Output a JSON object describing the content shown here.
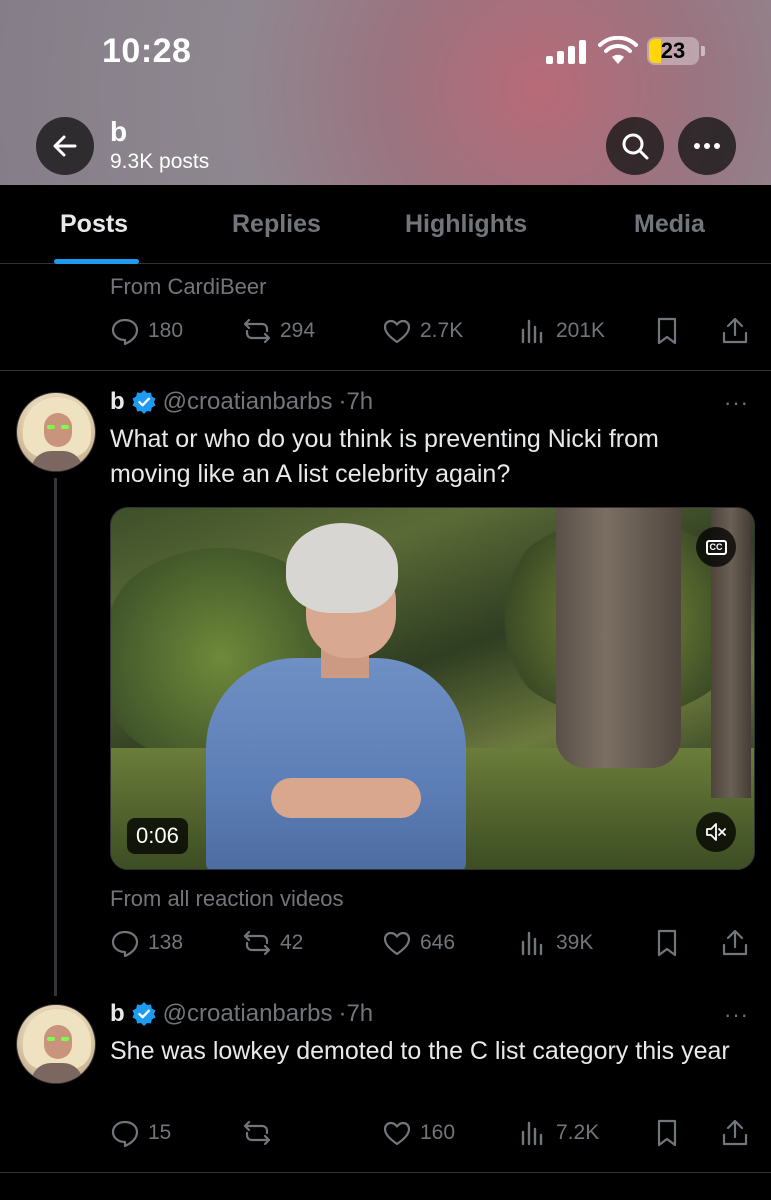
{
  "status_bar": {
    "time": "10:28",
    "battery": "23"
  },
  "header": {
    "name": "b",
    "post_count": "9.3K posts"
  },
  "tabs": [
    {
      "label": "Posts",
      "active": true
    },
    {
      "label": "Replies",
      "active": false
    },
    {
      "label": "Highlights",
      "active": false
    },
    {
      "label": "Media",
      "active": false
    }
  ],
  "top_post": {
    "from": "From CardiBeer",
    "replies": "180",
    "reposts": "294",
    "likes": "2.7K",
    "views": "201K"
  },
  "posts": [
    {
      "name": "b",
      "handle": "@croatianbarbs",
      "time": "·7h",
      "text": "What or who do you think is preventing Nicki from moving like an A list celebrity again?",
      "video_duration": "0:06",
      "from": "From all reaction videos",
      "replies": "138",
      "reposts": "42",
      "likes": "646",
      "views": "39K"
    },
    {
      "name": "b",
      "handle": "@croatianbarbs",
      "time": "·7h",
      "text": "She was lowkey demoted to the C list category this year",
      "replies": "15",
      "reposts": "",
      "likes": "160",
      "views": "7.2K"
    }
  ],
  "more_symbol": "···",
  "colors": {
    "accent": "#1d9bf0",
    "muted": "#71767b",
    "text": "#e7e9ea",
    "background": "#000000"
  },
  "icons": [
    "back-arrow-icon",
    "search-icon",
    "more-icon",
    "verified-icon",
    "reply-icon",
    "repost-icon",
    "like-icon",
    "views-icon",
    "bookmark-icon",
    "share-icon",
    "captions-icon",
    "mute-icon"
  ]
}
